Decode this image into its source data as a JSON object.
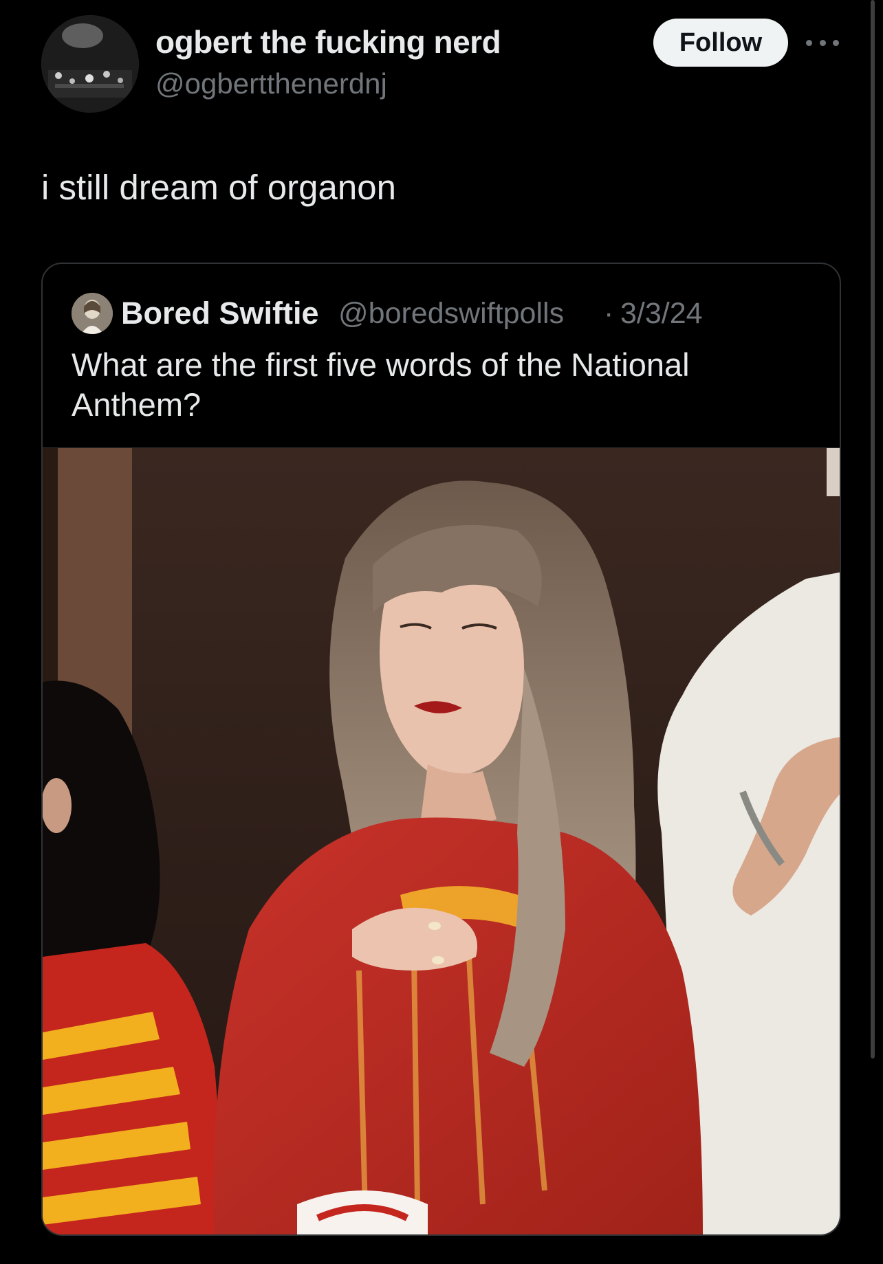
{
  "tweet": {
    "display_name": "ogbert the fucking nerd",
    "handle": "@ogbertthenerdnj",
    "follow_label": "Follow",
    "text": "i still dream of organon",
    "avatar_icon": "concert-crowd-avatar",
    "more_icon": "more-options-icon"
  },
  "quote": {
    "display_name": "Bored Swiftie",
    "handle": "@boredswiftpolls",
    "separator": "·",
    "date": "3/3/24",
    "text": "What are the first five words of the National Anthem?",
    "avatar_icon": "portrait-avatar",
    "photo_description_icon": "photo-of-woman-in-red-sweater"
  },
  "colors": {
    "background": "#000000",
    "primary_text": "#e7e9ea",
    "secondary_text": "#71767b",
    "border": "#2f3336",
    "follow_bg": "#eff3f4",
    "follow_text": "#0f1419"
  }
}
